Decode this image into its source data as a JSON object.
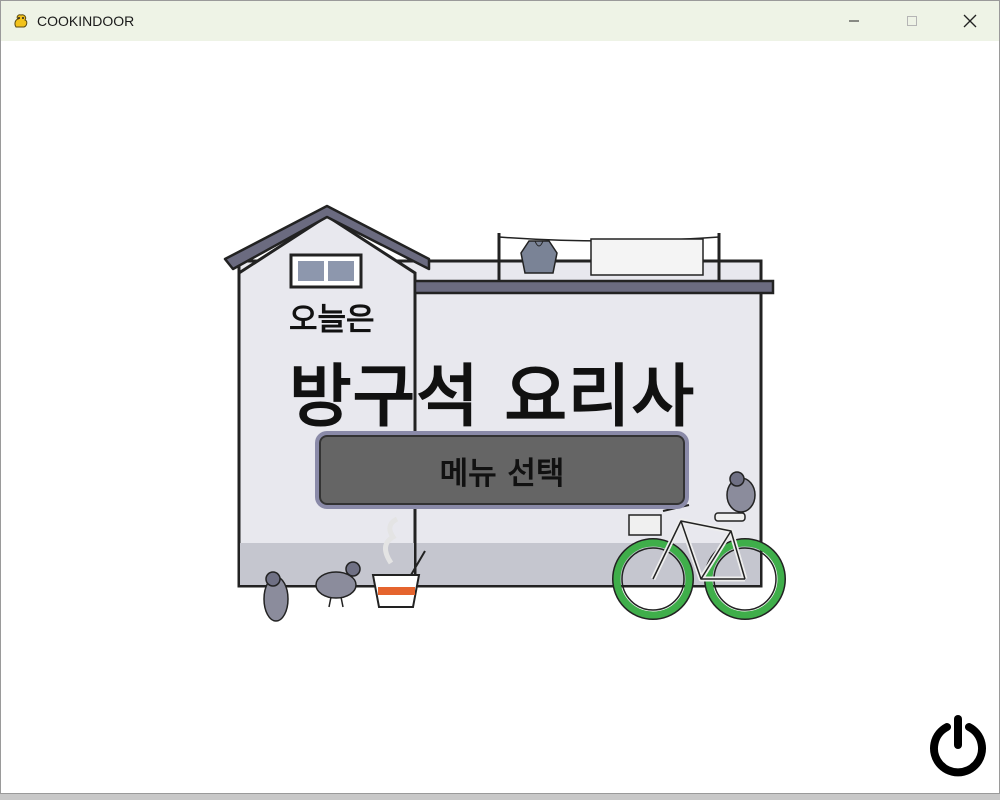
{
  "window": {
    "title": "COOKINDOOR",
    "icon": "pygame-snake-icon",
    "controls": [
      "minimize-icon",
      "maximize-icon",
      "close-icon"
    ]
  },
  "main": {
    "subtitle": "오늘은",
    "title": "방구석 요리사",
    "menu_button_label": "메뉴 선택",
    "power_icon": "power-icon"
  },
  "colors": {
    "titlebar": "#eef3e6",
    "wall": "#e8e8ee",
    "roof": "#6b6b80",
    "button_fill": "#656565",
    "button_border": "#8a8aa8",
    "bike_wheel": "#3fae4a"
  }
}
